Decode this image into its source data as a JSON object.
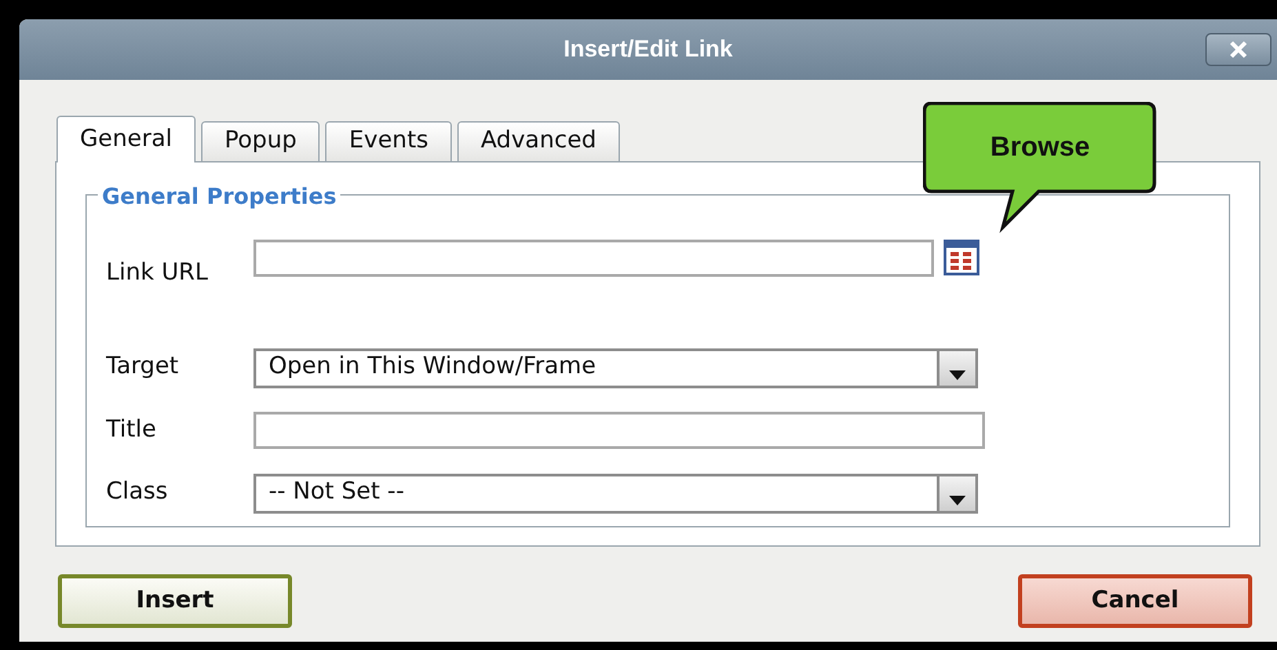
{
  "window": {
    "title": "Insert/Edit Link"
  },
  "tabs": [
    {
      "label": "General",
      "selected": true
    },
    {
      "label": "Popup",
      "selected": false
    },
    {
      "label": "Events",
      "selected": false
    },
    {
      "label": "Advanced",
      "selected": false
    }
  ],
  "fieldset": {
    "legend": "General Properties"
  },
  "fields": [
    {
      "label": "Link URL",
      "kind": "text",
      "browse": true
    },
    {
      "label": "Target",
      "kind": "select",
      "value": "Open in This Window/Frame"
    },
    {
      "label": "Title",
      "kind": "text"
    },
    {
      "label": "Class",
      "kind": "select",
      "value": "-- Not Set --"
    }
  ],
  "callout": {
    "text": "Browse"
  },
  "buttons": [
    {
      "label": "Insert",
      "kind": "primary"
    },
    {
      "label": "Cancel",
      "kind": "cancel"
    }
  ]
}
